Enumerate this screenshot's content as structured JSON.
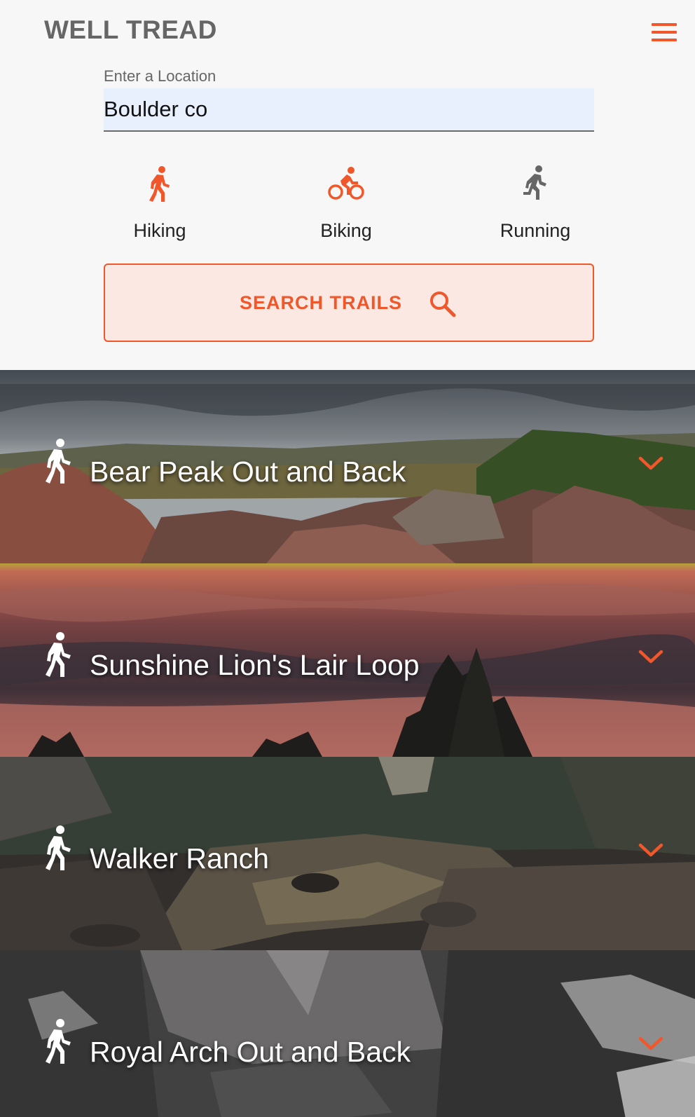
{
  "header": {
    "brand": "WELL TREAD",
    "menu_icon": "hamburger-menu-icon",
    "accent_color": "#f0572a"
  },
  "location": {
    "label": "Enter a Location",
    "value": "Boulder co"
  },
  "activities": [
    {
      "label": "Hiking",
      "icon": "hiking-icon",
      "selected": true,
      "color": "#f0572a"
    },
    {
      "label": "Biking",
      "icon": "biking-icon",
      "selected": true,
      "color": "#f0572a"
    },
    {
      "label": "Running",
      "icon": "running-icon",
      "selected": false,
      "color": "#666666"
    }
  ],
  "search": {
    "label": "SEARCH TRAILS",
    "icon": "search-icon"
  },
  "trails": [
    {
      "name": "Bear Peak Out and Back",
      "icon": "hiking-icon",
      "expand_icon": "chevron-down-icon"
    },
    {
      "name": "Sunshine Lion's Lair Loop",
      "icon": "hiking-icon",
      "expand_icon": "chevron-down-icon"
    },
    {
      "name": "Walker Ranch",
      "icon": "hiking-icon",
      "expand_icon": "chevron-down-icon"
    },
    {
      "name": "Royal Arch Out and Back",
      "icon": "hiking-icon",
      "expand_icon": "chevron-down-icon"
    }
  ]
}
